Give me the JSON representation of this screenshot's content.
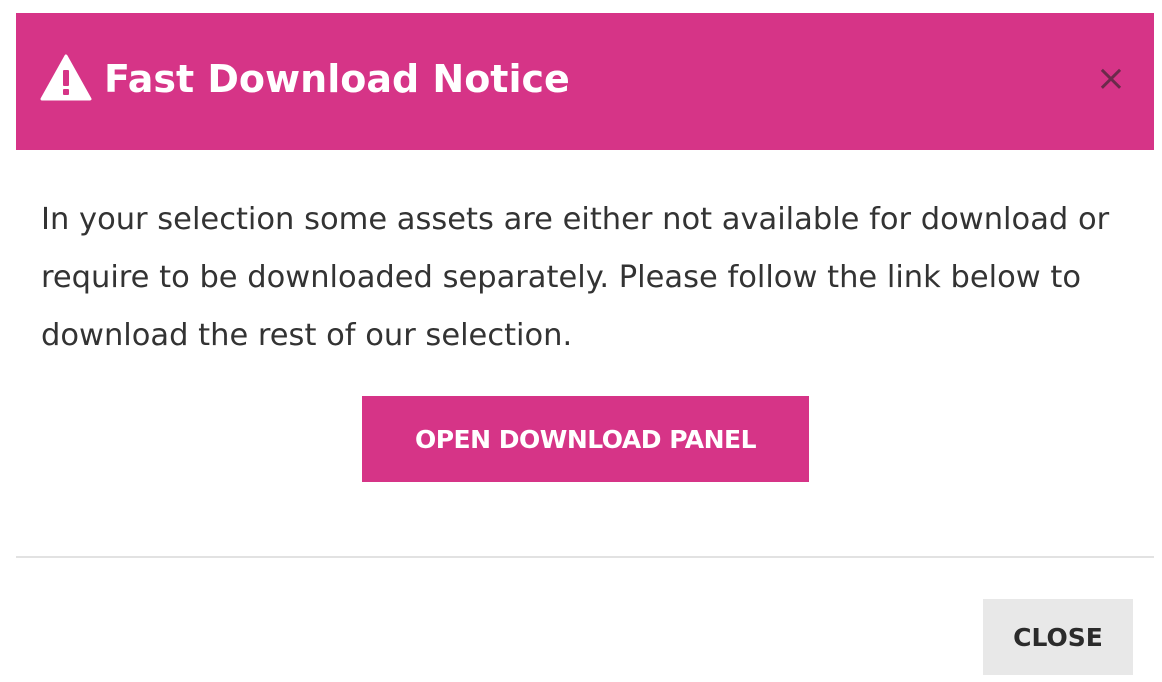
{
  "dialog": {
    "title": "Fast Download Notice",
    "header_icon": "warning-triangle-icon",
    "close_icon": "close-icon",
    "close_glyph": "×",
    "message": "In your selection some assets are either not available for download or require to be downloaded separately. Please follow the link below to download the rest of our selection.",
    "primary_button_label": "OPEN DOWNLOAD PANEL",
    "secondary_button_label": "CLOSE"
  },
  "colors": {
    "accent": "#d63487",
    "header_text": "#ffffff",
    "body_text": "#333333",
    "secondary_button_bg": "#e8e8e8"
  }
}
